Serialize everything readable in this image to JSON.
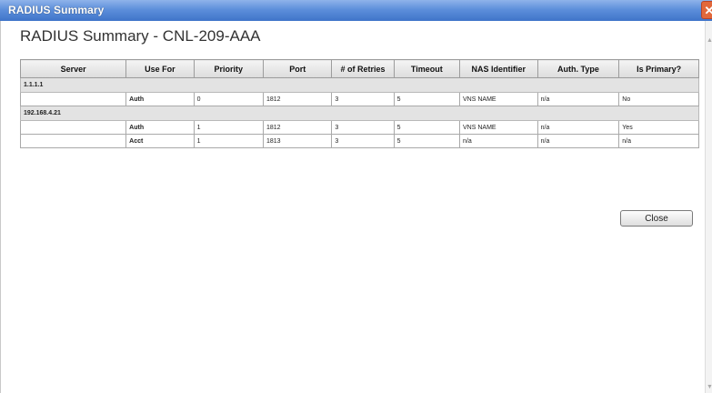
{
  "window": {
    "title": "RADIUS Summary",
    "close_glyph": "✕"
  },
  "heading": "RADIUS Summary - CNL-209-AAA",
  "table": {
    "columns": [
      "Server",
      "Use For",
      "Priority",
      "Port",
      "# of Retries",
      "Timeout",
      "NAS Identifier",
      "Auth. Type",
      "Is Primary?"
    ],
    "groups": [
      {
        "server": "1.1.1.1",
        "rows": [
          {
            "use_for": "Auth",
            "priority": "0",
            "port": "1812",
            "retries": "3",
            "timeout": "5",
            "nas": "VNS NAME",
            "auth_type": "n/a",
            "is_primary": "No"
          }
        ]
      },
      {
        "server": "192.168.4.21",
        "rows": [
          {
            "use_for": "Auth",
            "priority": "1",
            "port": "1812",
            "retries": "3",
            "timeout": "5",
            "nas": "VNS NAME",
            "auth_type": "n/a",
            "is_primary": "Yes"
          },
          {
            "use_for": "Acct",
            "priority": "1",
            "port": "1813",
            "retries": "3",
            "timeout": "5",
            "nas": "n/a",
            "auth_type": "n/a",
            "is_primary": "n/a"
          }
        ]
      }
    ]
  },
  "buttons": {
    "close": "Close"
  }
}
